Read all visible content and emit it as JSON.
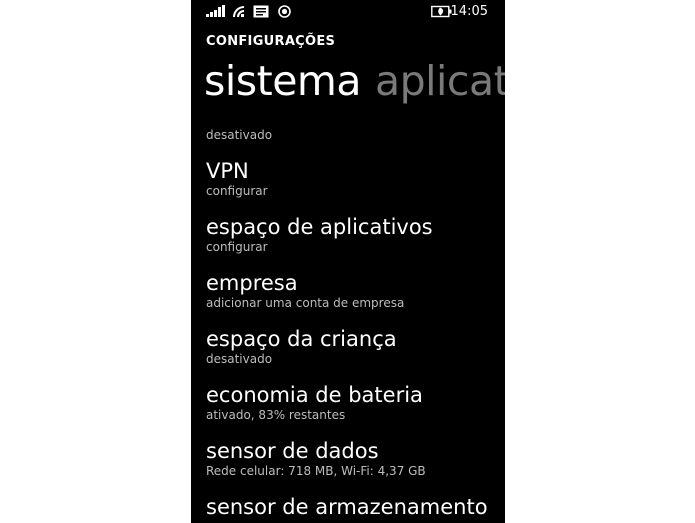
{
  "status_bar": {
    "icons": [
      "signal-strength-icon",
      "wifi-icon",
      "message-icon",
      "location-icon",
      "battery-saver-icon"
    ],
    "time": "14:05"
  },
  "header": {
    "app_title": "CONFIGURAÇÕES"
  },
  "pivot": {
    "active": "sistema",
    "next": "aplicati"
  },
  "top_partial_subtitle": "desativado",
  "items": [
    {
      "title": "VPN",
      "subtitle": "configurar"
    },
    {
      "title": "espaço de aplicativos",
      "subtitle": "configurar"
    },
    {
      "title": "empresa",
      "subtitle": "adicionar uma conta de empresa"
    },
    {
      "title": "espaço da criança",
      "subtitle": "desativado"
    },
    {
      "title": "economia de bateria",
      "subtitle": "ativado, 83% restantes"
    },
    {
      "title": "sensor de dados",
      "subtitle": "Rede celular: 718 MB, Wi-Fi: 4,37 GB"
    },
    {
      "title": "sensor de armazenamento",
      "subtitle": ""
    }
  ],
  "colors": {
    "background": "#000000",
    "text": "#ffffff",
    "subtext": "#bdbdbd",
    "pivot_inactive": "#7a7a7a"
  }
}
